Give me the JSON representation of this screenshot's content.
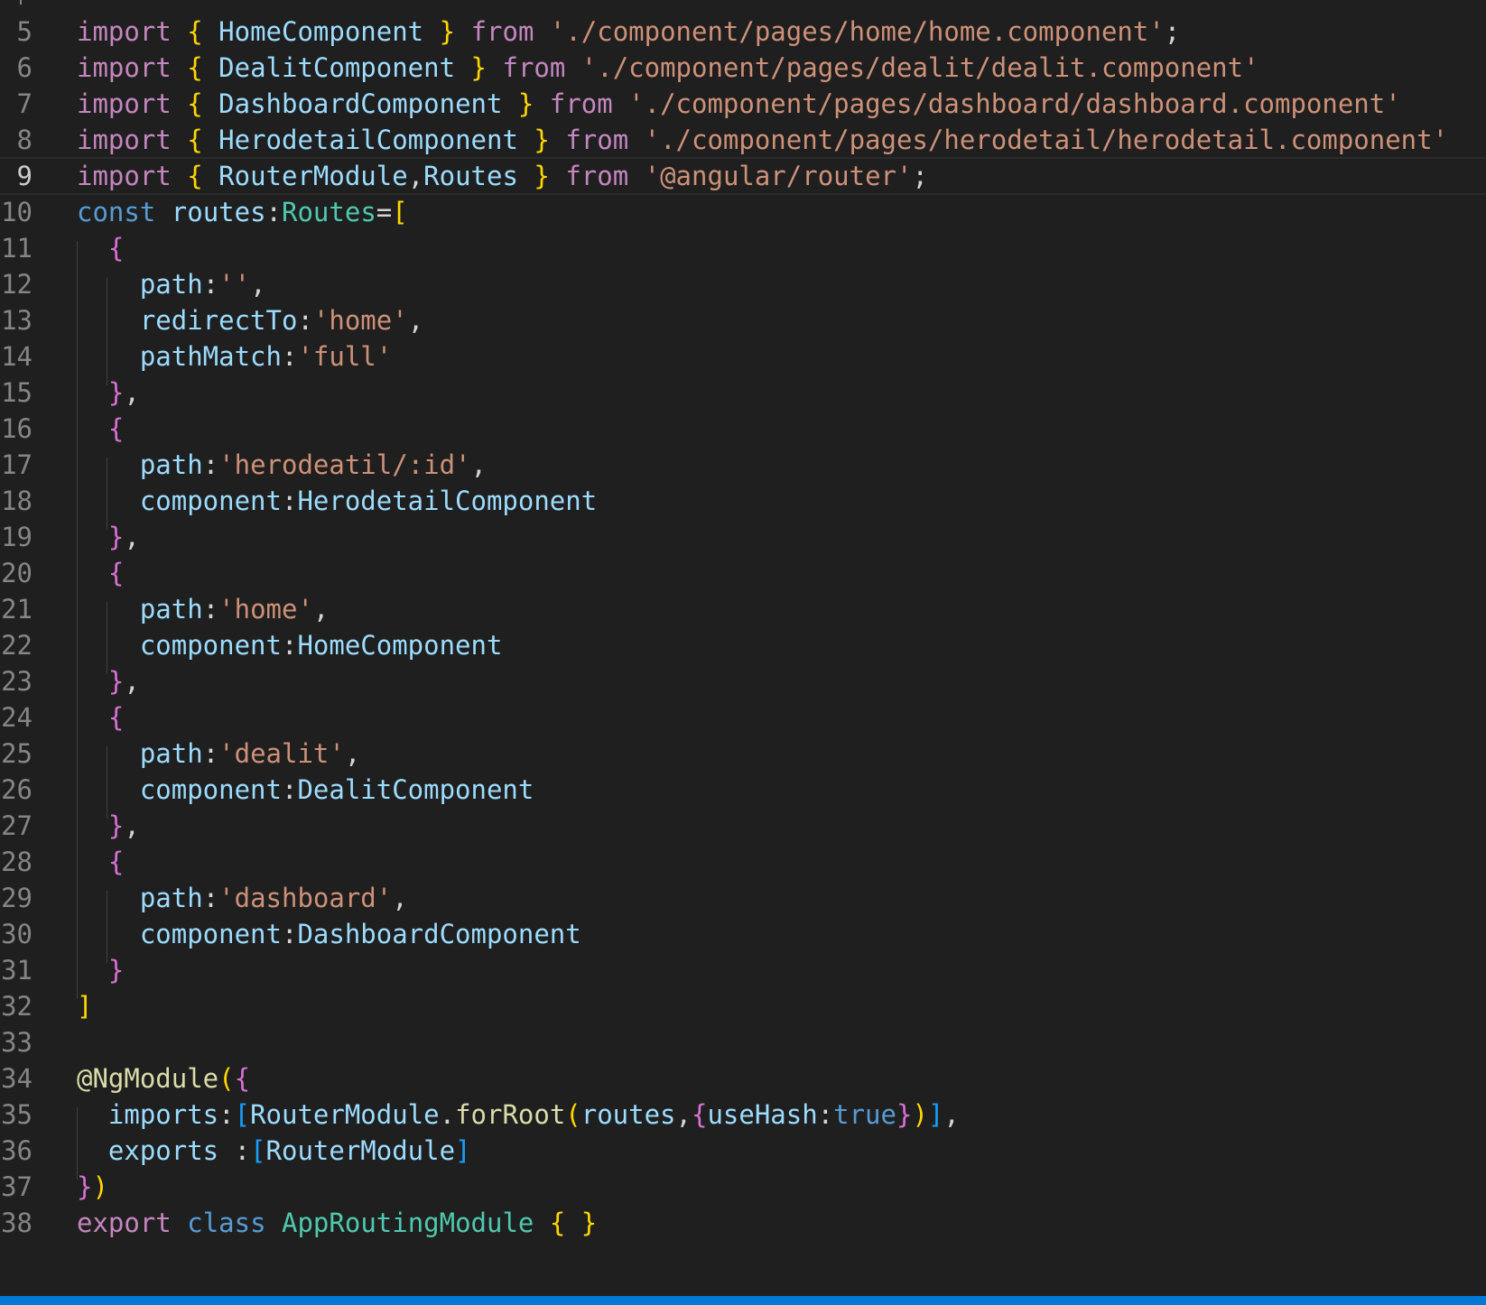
{
  "editor": {
    "theme_colors": {
      "background": "#1f1f1f",
      "line_number": "#858585",
      "keyword": "#c586c0",
      "string": "#ce9178",
      "identifier": "#9cdcfe",
      "type": "#4ec9b0",
      "function": "#dcdcaa",
      "storage": "#569cd6",
      "bracket_level_1": "#ffd700",
      "bracket_level_2": "#da70d6",
      "bracket_level_3": "#179fff",
      "status_bar": "#0078d4"
    },
    "current_line": "9",
    "lines": [
      {
        "num": "5",
        "tokens": [
          [
            "kw",
            "import"
          ],
          [
            "pn",
            " "
          ],
          [
            "b1",
            "{"
          ],
          [
            "pn",
            " "
          ],
          [
            "id",
            "HomeComponent"
          ],
          [
            "pn",
            " "
          ],
          [
            "b1",
            "}"
          ],
          [
            "pn",
            " "
          ],
          [
            "kw",
            "from"
          ],
          [
            "pn",
            " "
          ],
          [
            "st",
            "'./component/pages/home/home.component'"
          ],
          [
            "pn",
            ";"
          ]
        ]
      },
      {
        "num": "6",
        "tokens": [
          [
            "kw",
            "import"
          ],
          [
            "pn",
            " "
          ],
          [
            "b1",
            "{"
          ],
          [
            "pn",
            " "
          ],
          [
            "id",
            "DealitComponent"
          ],
          [
            "pn",
            " "
          ],
          [
            "b1",
            "}"
          ],
          [
            "pn",
            " "
          ],
          [
            "kw",
            "from"
          ],
          [
            "pn",
            " "
          ],
          [
            "st",
            "'./component/pages/dealit/dealit.component'"
          ]
        ]
      },
      {
        "num": "7",
        "tokens": [
          [
            "kw",
            "import"
          ],
          [
            "pn",
            " "
          ],
          [
            "b1",
            "{"
          ],
          [
            "pn",
            " "
          ],
          [
            "id",
            "DashboardComponent"
          ],
          [
            "pn",
            " "
          ],
          [
            "b1",
            "}"
          ],
          [
            "pn",
            " "
          ],
          [
            "kw",
            "from"
          ],
          [
            "pn",
            " "
          ],
          [
            "st",
            "'./component/pages/dashboard/dashboard.component'"
          ]
        ]
      },
      {
        "num": "8",
        "tokens": [
          [
            "kw",
            "import"
          ],
          [
            "pn",
            " "
          ],
          [
            "b1",
            "{"
          ],
          [
            "pn",
            " "
          ],
          [
            "id",
            "HerodetailComponent"
          ],
          [
            "pn",
            " "
          ],
          [
            "b1",
            "}"
          ],
          [
            "pn",
            " "
          ],
          [
            "kw",
            "from"
          ],
          [
            "pn",
            " "
          ],
          [
            "st",
            "'./component/pages/herodetail/herodetail.component'"
          ]
        ]
      },
      {
        "num": "9",
        "tokens": [
          [
            "kw",
            "import"
          ],
          [
            "pn",
            " "
          ],
          [
            "b1",
            "{"
          ],
          [
            "pn",
            " "
          ],
          [
            "id",
            "RouterModule"
          ],
          [
            "pn",
            ","
          ],
          [
            "id",
            "Routes"
          ],
          [
            "pn",
            " "
          ],
          [
            "b1",
            "}"
          ],
          [
            "pn",
            " "
          ],
          [
            "kw",
            "from"
          ],
          [
            "pn",
            " "
          ],
          [
            "st",
            "'@angular/router'"
          ],
          [
            "pn",
            ";"
          ]
        ]
      },
      {
        "num": "10",
        "tokens": [
          [
            "bk",
            "const"
          ],
          [
            "pn",
            " "
          ],
          [
            "id",
            "routes"
          ],
          [
            "pn",
            ":"
          ],
          [
            "ty",
            "Routes"
          ],
          [
            "pn",
            "="
          ],
          [
            "b1",
            "["
          ]
        ]
      },
      {
        "num": "11",
        "tokens": [
          [
            "pn",
            "  "
          ],
          [
            "b2",
            "{"
          ]
        ]
      },
      {
        "num": "12",
        "tokens": [
          [
            "pn",
            "    "
          ],
          [
            "id",
            "path"
          ],
          [
            "pn",
            ":"
          ],
          [
            "st",
            "''"
          ],
          [
            "pn",
            ","
          ]
        ]
      },
      {
        "num": "13",
        "tokens": [
          [
            "pn",
            "    "
          ],
          [
            "id",
            "redirectTo"
          ],
          [
            "pn",
            ":"
          ],
          [
            "st",
            "'home'"
          ],
          [
            "pn",
            ","
          ]
        ]
      },
      {
        "num": "14",
        "tokens": [
          [
            "pn",
            "    "
          ],
          [
            "id",
            "pathMatch"
          ],
          [
            "pn",
            ":"
          ],
          [
            "st",
            "'full'"
          ]
        ]
      },
      {
        "num": "15",
        "tokens": [
          [
            "pn",
            "  "
          ],
          [
            "b2",
            "}"
          ],
          [
            "pn",
            ","
          ]
        ]
      },
      {
        "num": "16",
        "tokens": [
          [
            "pn",
            "  "
          ],
          [
            "b2",
            "{"
          ]
        ]
      },
      {
        "num": "17",
        "tokens": [
          [
            "pn",
            "    "
          ],
          [
            "id",
            "path"
          ],
          [
            "pn",
            ":"
          ],
          [
            "st",
            "'herodeatil/:id'"
          ],
          [
            "pn",
            ","
          ]
        ]
      },
      {
        "num": "18",
        "tokens": [
          [
            "pn",
            "    "
          ],
          [
            "id",
            "component"
          ],
          [
            "pn",
            ":"
          ],
          [
            "id",
            "HerodetailComponent"
          ]
        ]
      },
      {
        "num": "19",
        "tokens": [
          [
            "pn",
            "  "
          ],
          [
            "b2",
            "}"
          ],
          [
            "pn",
            ","
          ]
        ]
      },
      {
        "num": "20",
        "tokens": [
          [
            "pn",
            "  "
          ],
          [
            "b2",
            "{"
          ]
        ]
      },
      {
        "num": "21",
        "tokens": [
          [
            "pn",
            "    "
          ],
          [
            "id",
            "path"
          ],
          [
            "pn",
            ":"
          ],
          [
            "st",
            "'home'"
          ],
          [
            "pn",
            ","
          ]
        ]
      },
      {
        "num": "22",
        "tokens": [
          [
            "pn",
            "    "
          ],
          [
            "id",
            "component"
          ],
          [
            "pn",
            ":"
          ],
          [
            "id",
            "HomeComponent"
          ]
        ]
      },
      {
        "num": "23",
        "tokens": [
          [
            "pn",
            "  "
          ],
          [
            "b2",
            "}"
          ],
          [
            "pn",
            ","
          ]
        ]
      },
      {
        "num": "24",
        "tokens": [
          [
            "pn",
            "  "
          ],
          [
            "b2",
            "{"
          ]
        ]
      },
      {
        "num": "25",
        "tokens": [
          [
            "pn",
            "    "
          ],
          [
            "id",
            "path"
          ],
          [
            "pn",
            ":"
          ],
          [
            "st",
            "'dealit'"
          ],
          [
            "pn",
            ","
          ]
        ]
      },
      {
        "num": "26",
        "tokens": [
          [
            "pn",
            "    "
          ],
          [
            "id",
            "component"
          ],
          [
            "pn",
            ":"
          ],
          [
            "id",
            "DealitComponent"
          ]
        ]
      },
      {
        "num": "27",
        "tokens": [
          [
            "pn",
            "  "
          ],
          [
            "b2",
            "}"
          ],
          [
            "pn",
            ","
          ]
        ]
      },
      {
        "num": "28",
        "tokens": [
          [
            "pn",
            "  "
          ],
          [
            "b2",
            "{"
          ]
        ]
      },
      {
        "num": "29",
        "tokens": [
          [
            "pn",
            "    "
          ],
          [
            "id",
            "path"
          ],
          [
            "pn",
            ":"
          ],
          [
            "st",
            "'dashboard'"
          ],
          [
            "pn",
            ","
          ]
        ]
      },
      {
        "num": "30",
        "tokens": [
          [
            "pn",
            "    "
          ],
          [
            "id",
            "component"
          ],
          [
            "pn",
            ":"
          ],
          [
            "id",
            "DashboardComponent"
          ]
        ]
      },
      {
        "num": "31",
        "tokens": [
          [
            "pn",
            "  "
          ],
          [
            "b2",
            "}"
          ]
        ]
      },
      {
        "num": "32",
        "tokens": [
          [
            "b1",
            "]"
          ]
        ]
      },
      {
        "num": "33",
        "tokens": []
      },
      {
        "num": "34",
        "tokens": [
          [
            "fn",
            "@NgModule"
          ],
          [
            "b1",
            "("
          ],
          [
            "b2",
            "{"
          ]
        ]
      },
      {
        "num": "35",
        "tokens": [
          [
            "pn",
            "  "
          ],
          [
            "id",
            "imports"
          ],
          [
            "pn",
            ":"
          ],
          [
            "b3",
            "["
          ],
          [
            "id",
            "RouterModule"
          ],
          [
            "pn",
            "."
          ],
          [
            "fn",
            "forRoot"
          ],
          [
            "b1",
            "("
          ],
          [
            "id",
            "routes"
          ],
          [
            "pn",
            ","
          ],
          [
            "b2",
            "{"
          ],
          [
            "id",
            "useHash"
          ],
          [
            "pn",
            ":"
          ],
          [
            "bk",
            "true"
          ],
          [
            "b2",
            "}"
          ],
          [
            "b1",
            ")"
          ],
          [
            "b3",
            "]"
          ],
          [
            "pn",
            ","
          ]
        ]
      },
      {
        "num": "36",
        "tokens": [
          [
            "pn",
            "  "
          ],
          [
            "id",
            "exports"
          ],
          [
            "pn",
            " :"
          ],
          [
            "b3",
            "["
          ],
          [
            "id",
            "RouterModule"
          ],
          [
            "b3",
            "]"
          ]
        ]
      },
      {
        "num": "37",
        "tokens": [
          [
            "b2",
            "}"
          ],
          [
            "b1",
            ")"
          ]
        ]
      },
      {
        "num": "38",
        "tokens": [
          [
            "kw",
            "export"
          ],
          [
            "pn",
            " "
          ],
          [
            "bk",
            "class"
          ],
          [
            "pn",
            " "
          ],
          [
            "ty",
            "AppRoutingModule"
          ],
          [
            "pn",
            " "
          ],
          [
            "b1",
            "{"
          ],
          [
            "pn",
            " "
          ],
          [
            "b1",
            "}"
          ]
        ]
      }
    ]
  }
}
